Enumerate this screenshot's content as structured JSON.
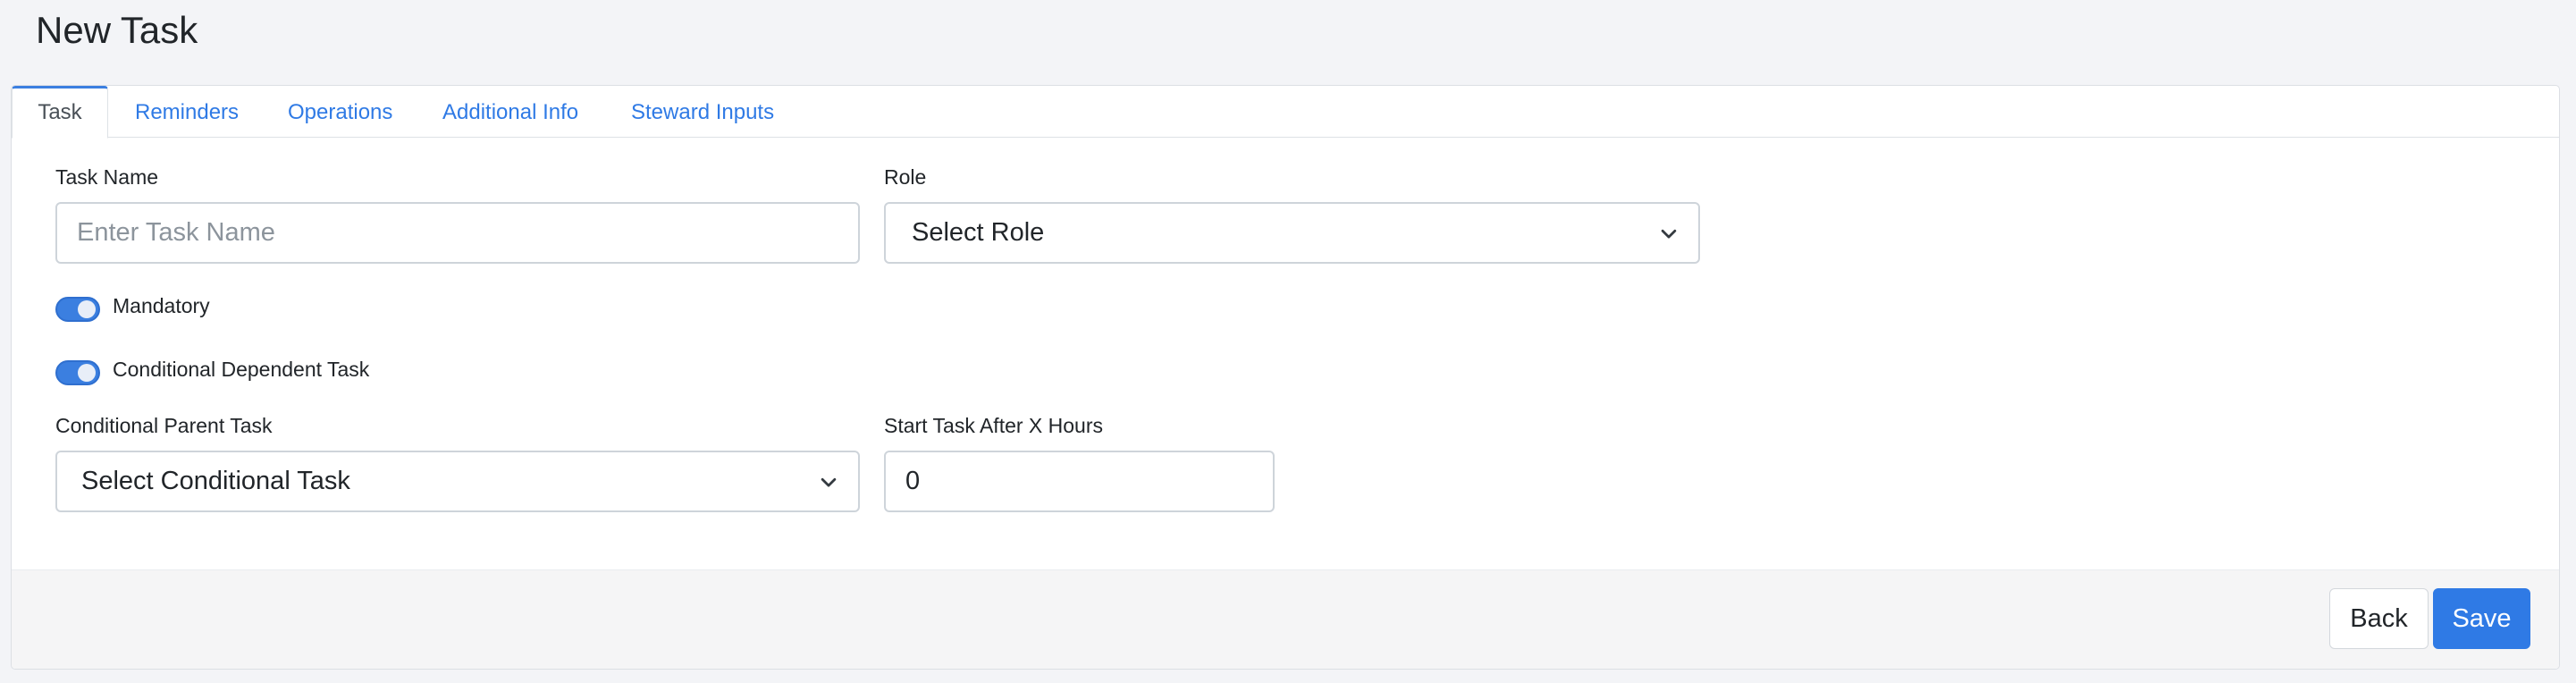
{
  "page": {
    "title": "New Task"
  },
  "tabs": [
    {
      "label": "Task",
      "active": true
    },
    {
      "label": "Reminders",
      "active": false
    },
    {
      "label": "Operations",
      "active": false
    },
    {
      "label": "Additional Info",
      "active": false
    },
    {
      "label": "Steward Inputs",
      "active": false
    }
  ],
  "form": {
    "task_name": {
      "label": "Task Name",
      "placeholder": "Enter Task Name",
      "value": ""
    },
    "role": {
      "label": "Role",
      "selected": "Select Role"
    },
    "mandatory": {
      "label": "Mandatory",
      "on": true
    },
    "conditional_dependent": {
      "label": "Conditional Dependent Task",
      "on": true
    },
    "conditional_parent": {
      "label": "Conditional Parent Task",
      "selected": "Select Conditional Task"
    },
    "start_after_hours": {
      "label": "Start Task After X Hours",
      "value": "0"
    }
  },
  "footer": {
    "back_label": "Back",
    "save_label": "Save"
  },
  "colors": {
    "accent": "#2f7ae5",
    "page_bg": "#f3f4f7",
    "footer_bg": "#f5f5f6"
  },
  "icons": {
    "select_caret": "chevron-down-icon"
  }
}
